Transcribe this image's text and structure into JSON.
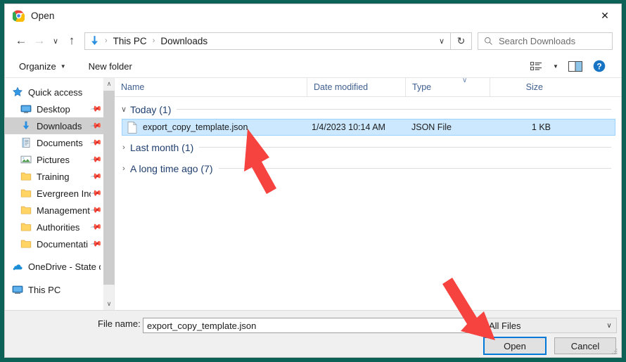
{
  "window": {
    "title": "Open",
    "app_icon": "chrome-icon",
    "close_label": "✕",
    "border_color": "#0d6257"
  },
  "navbar": {
    "back": "←",
    "forward": "→",
    "recent": "∨",
    "up": "↑",
    "refresh": "↻",
    "breadcrumb": {
      "icon": "downloads-arrow-icon",
      "items": [
        "This PC",
        "Downloads"
      ],
      "separator": "›",
      "dropdown": "∨"
    },
    "search": {
      "placeholder": "Search Downloads",
      "icon": "search-icon"
    }
  },
  "commandbar": {
    "organize": "Organize",
    "organize_caret": "▼",
    "new_folder": "New folder",
    "view_caret": "▼",
    "icons": [
      "view-options-icon",
      "view-dropdown-caret",
      "preview-pane-icon",
      "help-icon"
    ],
    "help_label": "?"
  },
  "sidebar": {
    "items": [
      {
        "label": "Quick access",
        "icon": "star-icon",
        "level": 0,
        "pinned": false,
        "selected": false
      },
      {
        "label": "Desktop",
        "icon": "desktop-icon",
        "level": 1,
        "pinned": true,
        "selected": false
      },
      {
        "label": "Downloads",
        "icon": "downloads-icon",
        "level": 1,
        "pinned": true,
        "selected": true
      },
      {
        "label": "Documents",
        "icon": "documents-icon",
        "level": 1,
        "pinned": true,
        "selected": false
      },
      {
        "label": "Pictures",
        "icon": "pictures-icon",
        "level": 1,
        "pinned": true,
        "selected": false
      },
      {
        "label": "Training",
        "icon": "folder-icon",
        "level": 1,
        "pinned": true,
        "selected": false
      },
      {
        "label": "Evergreen Inc",
        "icon": "folder-icon",
        "level": 1,
        "pinned": true,
        "selected": false
      },
      {
        "label": "Management",
        "icon": "folder-icon",
        "level": 1,
        "pinned": true,
        "selected": false
      },
      {
        "label": "Authorities",
        "icon": "folder-icon",
        "level": 1,
        "pinned": true,
        "selected": false
      },
      {
        "label": "Documentati",
        "icon": "folder-icon",
        "level": 1,
        "pinned": true,
        "selected": false
      },
      {
        "label": "OneDrive - State o",
        "icon": "onedrive-icon",
        "level": 0,
        "pinned": false,
        "selected": false
      },
      {
        "label": "This PC",
        "icon": "thispc-icon",
        "level": 0,
        "pinned": false,
        "selected": false
      }
    ],
    "scrollbar": {
      "up": "∧",
      "down": "∨"
    }
  },
  "filelist": {
    "columns": {
      "name": "Name",
      "date_modified": "Date modified",
      "type": "Type",
      "size": "Size"
    },
    "sort_indicator": "∨",
    "groups": [
      {
        "label": "Today (1)",
        "expanded": true,
        "chevron": "∨"
      },
      {
        "label": "Last month (1)",
        "expanded": false,
        "chevron": "›"
      },
      {
        "label": "A long time ago (7)",
        "expanded": false,
        "chevron": "›"
      }
    ],
    "rows": [
      {
        "icon": "json-file-icon",
        "name": "export_copy_template.json",
        "date_modified": "1/4/2023 10:14 AM",
        "type": "JSON File",
        "size": "1 KB",
        "selected": true
      }
    ]
  },
  "footer": {
    "filename_label": "File name:",
    "filename_value": "export_copy_template.json",
    "filename_caret": "∨",
    "filter_value": "All Files",
    "filter_caret": "∨",
    "open_label": "Open",
    "cancel_label": "Cancel"
  },
  "annotations": [
    {
      "name": "arrow-to-file-row",
      "color": "#f7433f"
    },
    {
      "name": "arrow-to-open-button",
      "color": "#f7433f"
    }
  ]
}
